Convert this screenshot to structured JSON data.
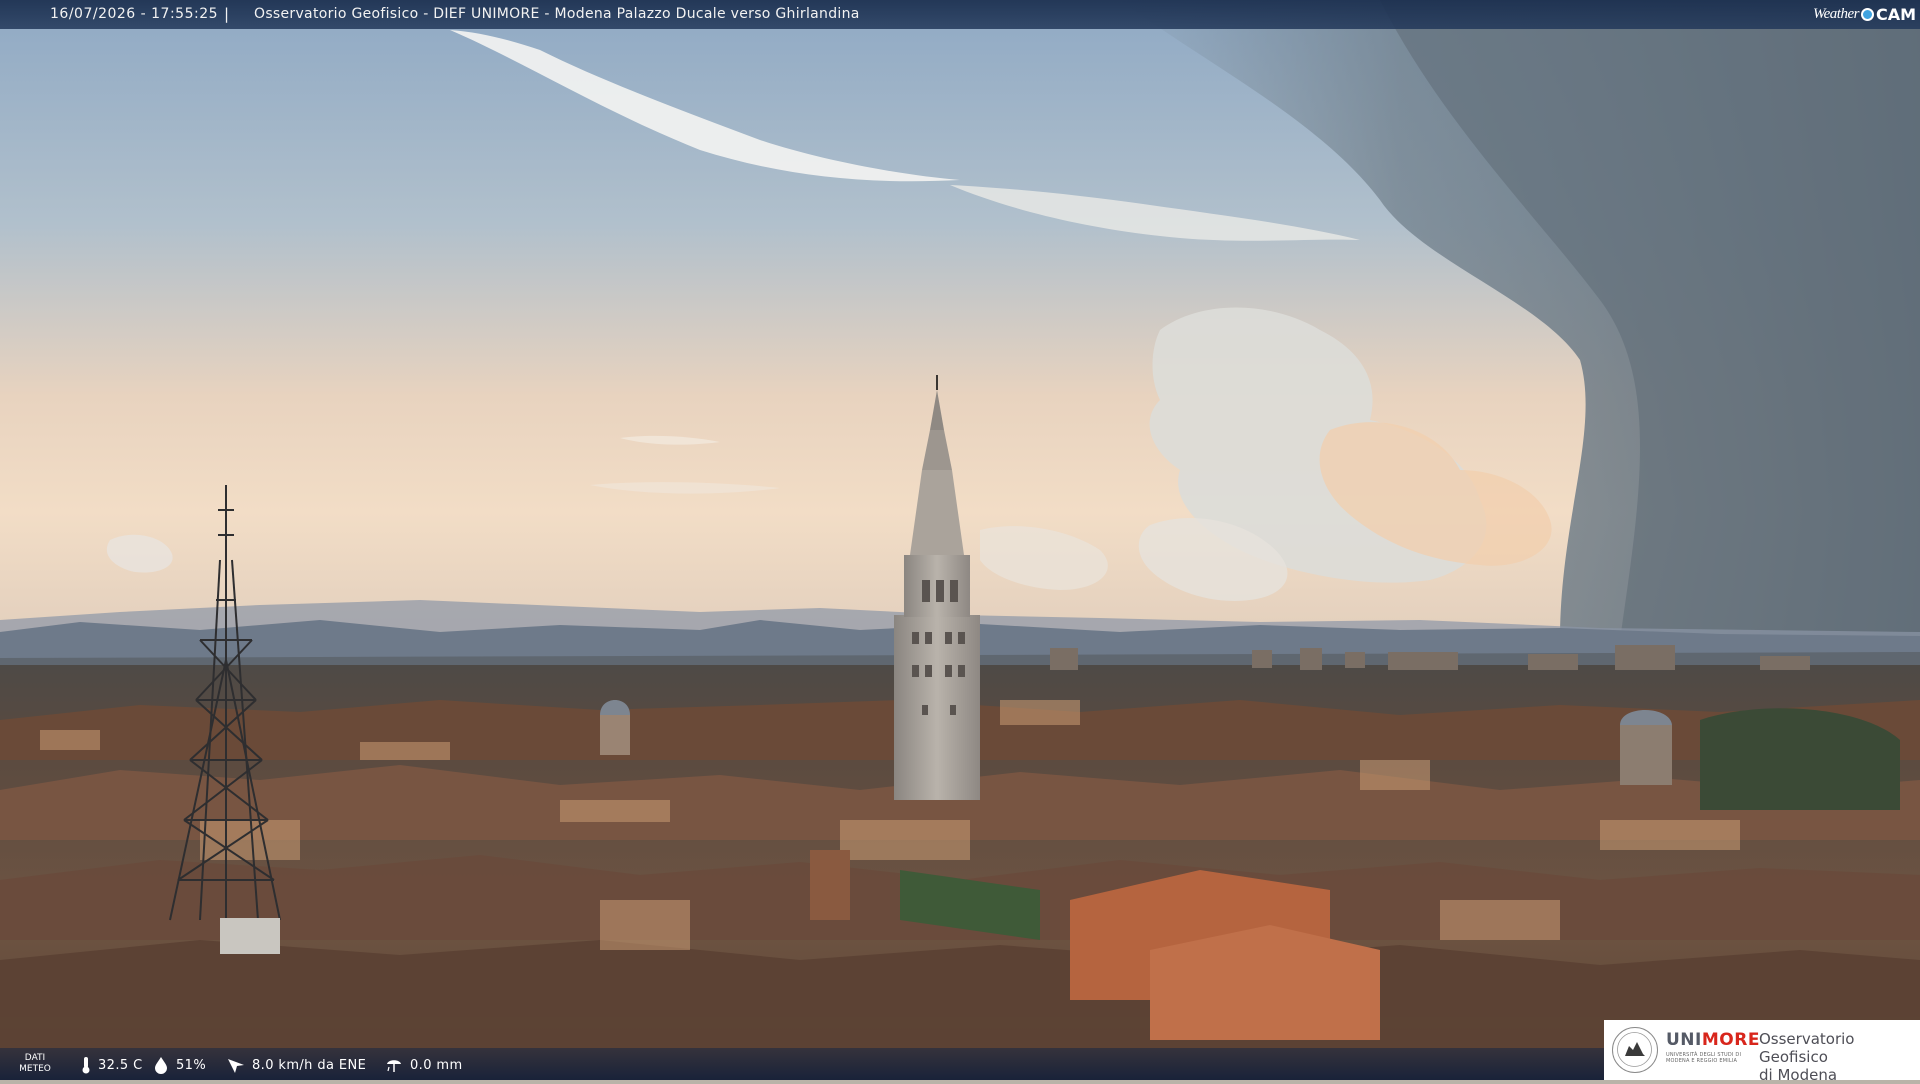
{
  "header": {
    "timestamp": "16/07/2026 - 17:55:25",
    "separator": "|",
    "title": "Osservatorio Geofisico - DIEF UNIMORE - Modena Palazzo Ducale verso Ghirlandina",
    "brand_text": "Weather",
    "brand_suffix": "CAM"
  },
  "meteo": {
    "label_line1": "DATI",
    "label_line2": "METEO",
    "temperature": "32.5 C",
    "humidity": "51%",
    "wind": "8.0 km/h da ENE",
    "rain": "0.0 mm"
  },
  "logo": {
    "uni_part1": "UNI",
    "uni_part2": "MORE",
    "uni_subtitle": "UNIVERSITÀ DEGLI STUDI DI MODENA E REGGIO EMILIA",
    "obs_line1": "Osservatorio Geofisico",
    "obs_line2": "di Modena"
  },
  "colors": {
    "header_bg": "#1a2e4e",
    "accent_red": "#d8261c",
    "logo_grey": "#555a66"
  },
  "icons": [
    "thermometer-icon",
    "humidity-drop-icon",
    "wind-direction-icon",
    "rain-gauge-icon",
    "university-seal-icon"
  ]
}
